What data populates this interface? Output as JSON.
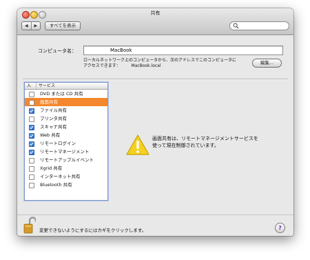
{
  "window": {
    "title": "共有"
  },
  "toolbar": {
    "back_glyph": "◀",
    "forward_glyph": "▶",
    "show_all_label": "すべてを表示",
    "search_placeholder": "",
    "search_icon": "magnifier-icon"
  },
  "computer": {
    "name_label": "コンピュータ名：",
    "name_value": "MacBook",
    "description_line1": "ローカルネットワーク上のコンピュータから、次のアドレスでこのコンピュータに",
    "description_line2_prefix": "アクセスできます：",
    "local_address": "MacBook.local",
    "edit_button": "編集..."
  },
  "services": {
    "header_on": "入",
    "header_service": "サービス",
    "items": [
      {
        "label": "DVD または CD 共有",
        "checked": false,
        "selected": false
      },
      {
        "label": "画面共有",
        "checked": false,
        "selected": true
      },
      {
        "label": "ファイル共有",
        "checked": true,
        "selected": false
      },
      {
        "label": "プリンタ共有",
        "checked": false,
        "selected": false
      },
      {
        "label": "スキャナ共有",
        "checked": true,
        "selected": false
      },
      {
        "label": "Web 共有",
        "checked": true,
        "selected": false
      },
      {
        "label": "リモートログイン",
        "checked": true,
        "selected": false
      },
      {
        "label": "リモートマネージメント",
        "checked": true,
        "selected": false
      },
      {
        "label": "リモートアップルイベント",
        "checked": false,
        "selected": false
      },
      {
        "label": "Xgrid 共有",
        "checked": false,
        "selected": false
      },
      {
        "label": "インターネット共有",
        "checked": false,
        "selected": false
      },
      {
        "label": "Bluetooth 共有",
        "checked": false,
        "selected": false
      }
    ]
  },
  "detail": {
    "warning_icon": "warning-triangle-icon",
    "message_line1": "画面共有は、リモートマネージメントサービスを",
    "message_line2": "使って現在制御されています。"
  },
  "footer": {
    "lock_icon": "lock-icon",
    "lock_text": "変更できないようにするにはカギをクリックします。",
    "help_glyph": "?"
  },
  "colors": {
    "selection": "#f4872c",
    "checkbox_on": "#2b67c9",
    "warning": "#f5d020"
  }
}
